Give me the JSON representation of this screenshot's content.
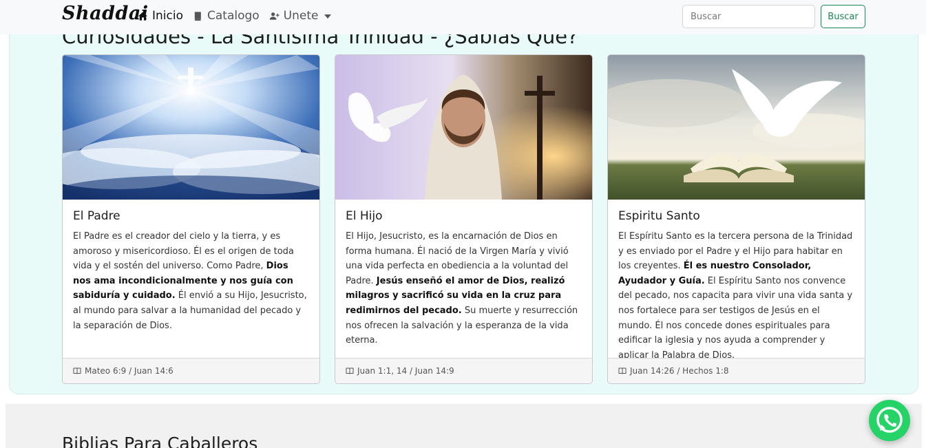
{
  "navbar": {
    "brand": "Shaddai",
    "links": [
      {
        "label": "Inicio",
        "icon": "home-icon"
      },
      {
        "label": "Catalogo",
        "icon": "book-icon"
      },
      {
        "label": "Unete",
        "icon": "user-plus-icon"
      }
    ],
    "search": {
      "placeholder": "Buscar",
      "button_label": "Buscar"
    }
  },
  "trinity_section": {
    "title": "Curiosidades - La Santisima Trinidad - ¿Sabias Que?",
    "cards": [
      {
        "title": "El Padre",
        "text_parts": [
          "El Padre es el creador del cielo y la tierra, y es amoroso y misericordioso. Él es el origen de toda vida y el sostén del universo. Como Padre, ",
          "Dios nos ama incondicionalmente y nos guía con sabiduría y cuidado.",
          " Él envió a su Hijo, Jesucristo, al mundo para salvar a la humanidad del pecado y la separación de Dios."
        ],
        "reference": "Mateo 6:9 / Juan 14:6",
        "image_icon": "heaven-clouds-image"
      },
      {
        "title": "El Hijo",
        "text_parts": [
          "El Hijo, Jesucristo, es la encarnación de Dios en forma humana. Él nació de la Virgen María y vivió una vida perfecta en obediencia a la voluntad del Padre. ",
          "Jesús enseñó el amor de Dios, realizó milagros y sacrificó su vida en la cruz para redimirnos del pecado.",
          " Su muerte y resurrección nos ofrecen la salvación y la esperanza de la vida eterna."
        ],
        "reference": "Juan 1:1, 14 / Juan 14:9",
        "image_icon": "jesus-dove-cross-image"
      },
      {
        "title": "Espiritu Santo",
        "text_parts": [
          "El Espíritu Santo es la tercera persona de la Trinidad y es enviado por el Padre y el Hijo para habitar en los creyentes. ",
          "Él es nuestro Consolador, Ayudador y Guía.",
          " El Espíritu Santo nos convence del pecado, nos capacita para vivir una vida santa y nos fortalece para ser testigos de Jesús en el mundo. Él nos concede dones espirituales para edificar la iglesia y nos ayuda a comprender y aplicar la Palabra de Dios."
        ],
        "reference": "Juan 14:26 / Hechos 1:8",
        "image_icon": "dove-open-bible-image"
      }
    ]
  },
  "bibles_section": {
    "title": "Biblias Para Caballeros"
  },
  "colors": {
    "accent_green": "#198754",
    "section_bg": "#e8fbf8",
    "whatsapp": "#25d366"
  },
  "floating": {
    "icon": "whatsapp-icon"
  }
}
